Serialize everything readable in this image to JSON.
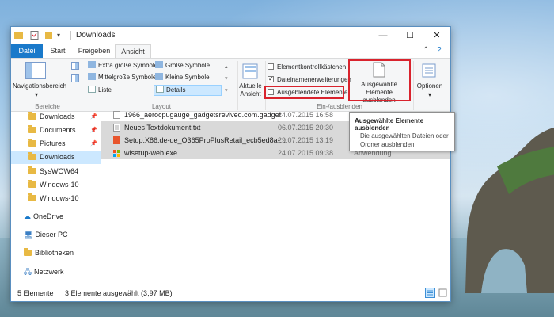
{
  "window": {
    "title": "Downloads",
    "controls": {
      "minimize": "—",
      "maximize": "☐",
      "close": "✕"
    }
  },
  "tabs": [
    {
      "label": "Datei"
    },
    {
      "label": "Start"
    },
    {
      "label": "Freigeben"
    },
    {
      "label": "Ansicht"
    }
  ],
  "ribbon": {
    "bereiche": {
      "nav_label": "Navigationsbereich",
      "group_label": "Bereiche"
    },
    "layout": {
      "items": [
        "Extra große Symbole",
        "Große Symbole",
        "Mittelgroße Symbole",
        "Kleine Symbole",
        "Liste",
        "Details"
      ],
      "group_label": "Layout"
    },
    "current_view": {
      "label": "Aktuelle Ansicht"
    },
    "show_hide": {
      "checkboxes": [
        {
          "label": "Elementkontrollkästchen",
          "checked": false
        },
        {
          "label": "Dateinamenerweiterungen",
          "checked": true
        },
        {
          "label": "Ausgeblendete Elemente",
          "checked": false
        }
      ],
      "hide_selected_label": "Ausgewählte Elemente ausblenden",
      "group_label": "Ein-/ausblenden"
    },
    "options_label": "Optionen"
  },
  "nav": [
    {
      "label": "Downloads",
      "pinned": true
    },
    {
      "label": "Documents",
      "pinned": true
    },
    {
      "label": "Pictures",
      "pinned": true
    },
    {
      "label": "Downloads",
      "selected": true
    },
    {
      "label": "SysWOW64"
    },
    {
      "label": "Windows-10"
    },
    {
      "label": "Windows-10"
    },
    {
      "label": "OneDrive"
    },
    {
      "label": "Dieser PC"
    },
    {
      "label": "Bibliotheken"
    },
    {
      "label": "Netzwerk"
    }
  ],
  "files": [
    {
      "name": "1966_aerocpugauge_gadgetsrevived.com.gadget",
      "date": "24.07.2015 16:58",
      "type": "",
      "selected": false
    },
    {
      "name": "Neues Textdokument.txt",
      "date": "06.07.2015 20:30",
      "type": "",
      "selected": true
    },
    {
      "name": "Setup.X86.de-de_O365ProPlusRetail_ecb5ed8a-...",
      "date": "29.07.2015 13:19",
      "type": "",
      "selected": true
    },
    {
      "name": "wlsetup-web.exe",
      "date": "24.07.2015 09:38",
      "type": "Anwendung",
      "selected": true
    }
  ],
  "status": {
    "count": "5 Elemente",
    "selection": "3 Elemente ausgewählt (3,97 MB)"
  },
  "tooltip": {
    "title": "Ausgewählte Elemente ausblenden",
    "body": "Die ausgewählten Dateien oder Ordner ausblenden."
  },
  "colors": {
    "accent": "#1979ca",
    "highlight_box": "#d9232d",
    "nav_selected": "#cce8ff",
    "row_selected": "#d9d9d9"
  }
}
